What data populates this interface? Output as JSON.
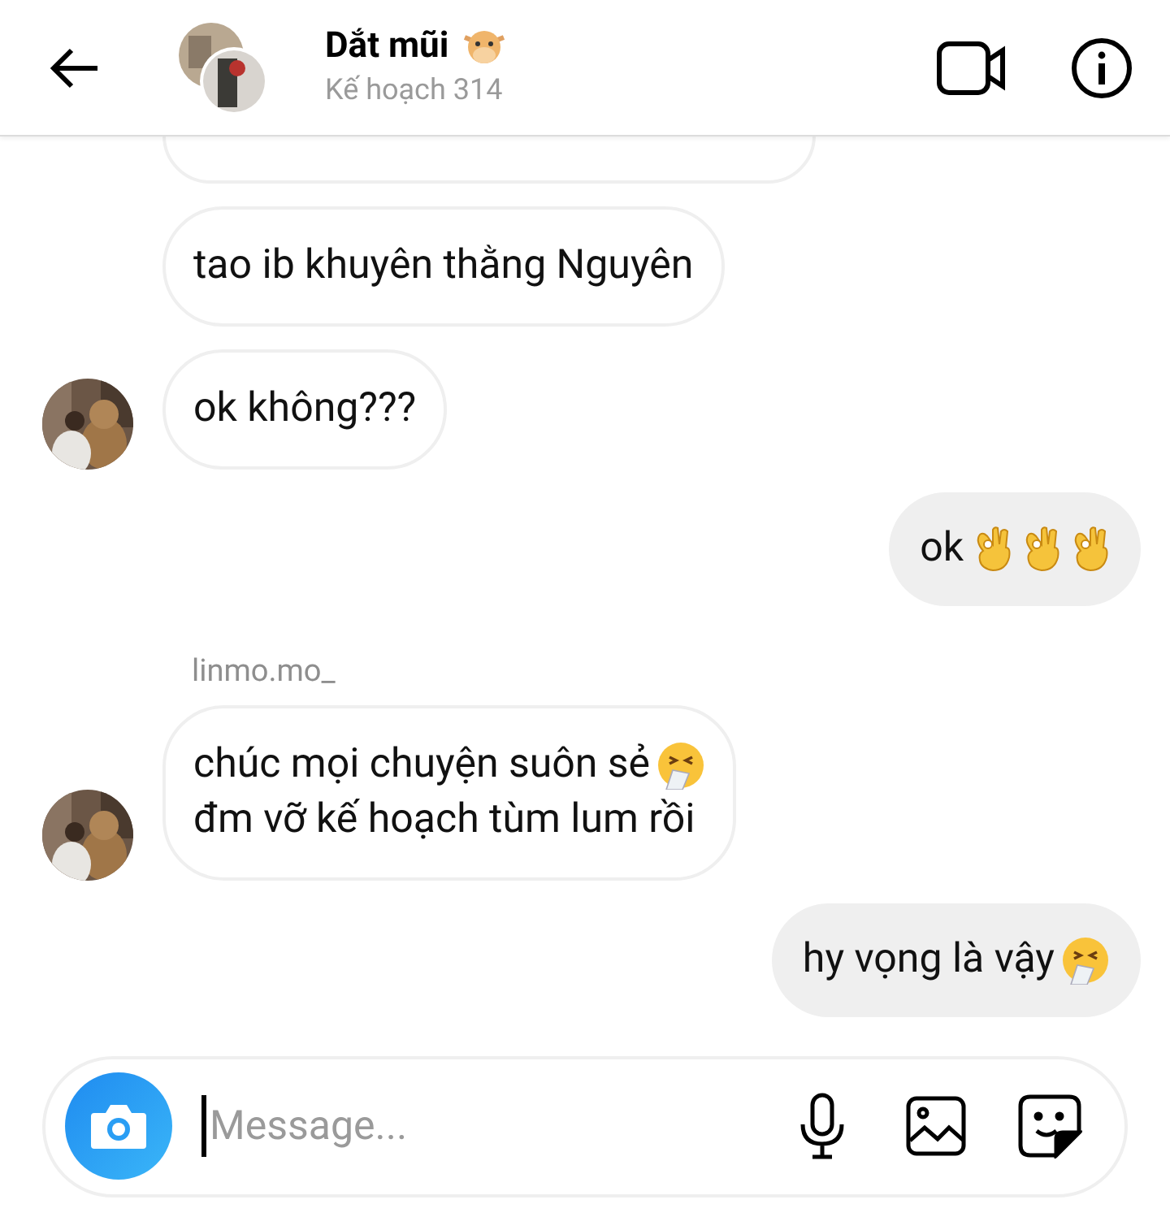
{
  "header": {
    "title": "Dắt mũi",
    "subtitle": "Kế hoạch 314"
  },
  "messages": [
    {
      "kind": "cut"
    },
    {
      "kind": "incoming",
      "lines": [
        "tao ib khuyên thằng Nguyên"
      ],
      "avatar": false
    },
    {
      "kind": "incoming",
      "lines": [
        "ok không???"
      ],
      "avatar": true
    },
    {
      "kind": "outgoing",
      "lines": [
        "ok"
      ],
      "emojis": [
        {
          "kind": "ok_hand"
        },
        {
          "kind": "ok_hand"
        },
        {
          "kind": "ok_hand"
        }
      ]
    },
    {
      "kind": "sender",
      "text": "linmo.mo_"
    },
    {
      "kind": "incoming",
      "lines": [
        "chúc mọi chuyện suôn sẻ",
        "đm vỡ kế hoạch tùm lum rồi"
      ],
      "emojis": [
        {
          "kind": "sneeze"
        }
      ],
      "avatar": true
    },
    {
      "kind": "outgoing",
      "lines": [
        "hy vọng là vậy"
      ],
      "emojis": [
        {
          "kind": "sneeze"
        }
      ]
    }
  ],
  "composer": {
    "placeholder": "Message..."
  }
}
